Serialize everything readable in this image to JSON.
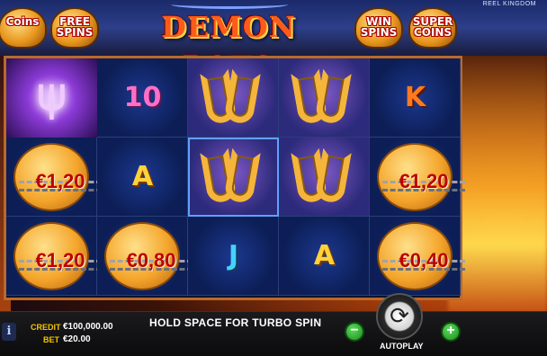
{
  "header": {
    "brand": "REEL KINGDOM",
    "logo": "DEMON POTS",
    "pots": [
      {
        "label": "Coins",
        "name": "coins-pot"
      },
      {
        "label": "FREE SPINS",
        "name": "free-spins-pot"
      },
      {
        "label": "WIN SPINS",
        "name": "win-spins-pot"
      },
      {
        "label": "SUPER COINS",
        "name": "super-coins-pot"
      }
    ]
  },
  "reels": {
    "rows": [
      [
        {
          "type": "trident",
          "icon": "trident-icon"
        },
        {
          "type": "letter",
          "value": "10"
        },
        {
          "type": "horseshoe",
          "icon": "horseshoe-icon"
        },
        {
          "type": "horseshoe",
          "icon": "horseshoe-icon"
        },
        {
          "type": "letter",
          "value": "K"
        }
      ],
      [
        {
          "type": "coin",
          "value": "€1,20"
        },
        {
          "type": "letter",
          "value": "A"
        },
        {
          "type": "horseshoe",
          "icon": "horseshoe-icon"
        },
        {
          "type": "horseshoe",
          "icon": "horseshoe-icon"
        },
        {
          "type": "coin",
          "value": "€1,20"
        }
      ],
      [
        {
          "type": "coin",
          "value": "€1,20"
        },
        {
          "type": "coin",
          "value": "€0,80"
        },
        {
          "type": "letter",
          "value": "J"
        },
        {
          "type": "letter",
          "value": "A"
        },
        {
          "type": "coin",
          "value": "€0,40"
        }
      ]
    ]
  },
  "footer": {
    "info_icon": "info-icon",
    "credit_label": "CREDIT",
    "credit_value": "€100,000.00",
    "bet_label": "BET",
    "bet_value": "€20.00",
    "message": "HOLD SPACE FOR TURBO SPIN",
    "minus_label": "−",
    "plus_label": "+",
    "spin_icon": "spin-arrows-icon",
    "autoplay_label": "AUTOPLAY"
  },
  "colors": {
    "frame": "#b86a2c",
    "accent_yellow": "#f5c400",
    "cell_blue": "#0c1e55"
  }
}
